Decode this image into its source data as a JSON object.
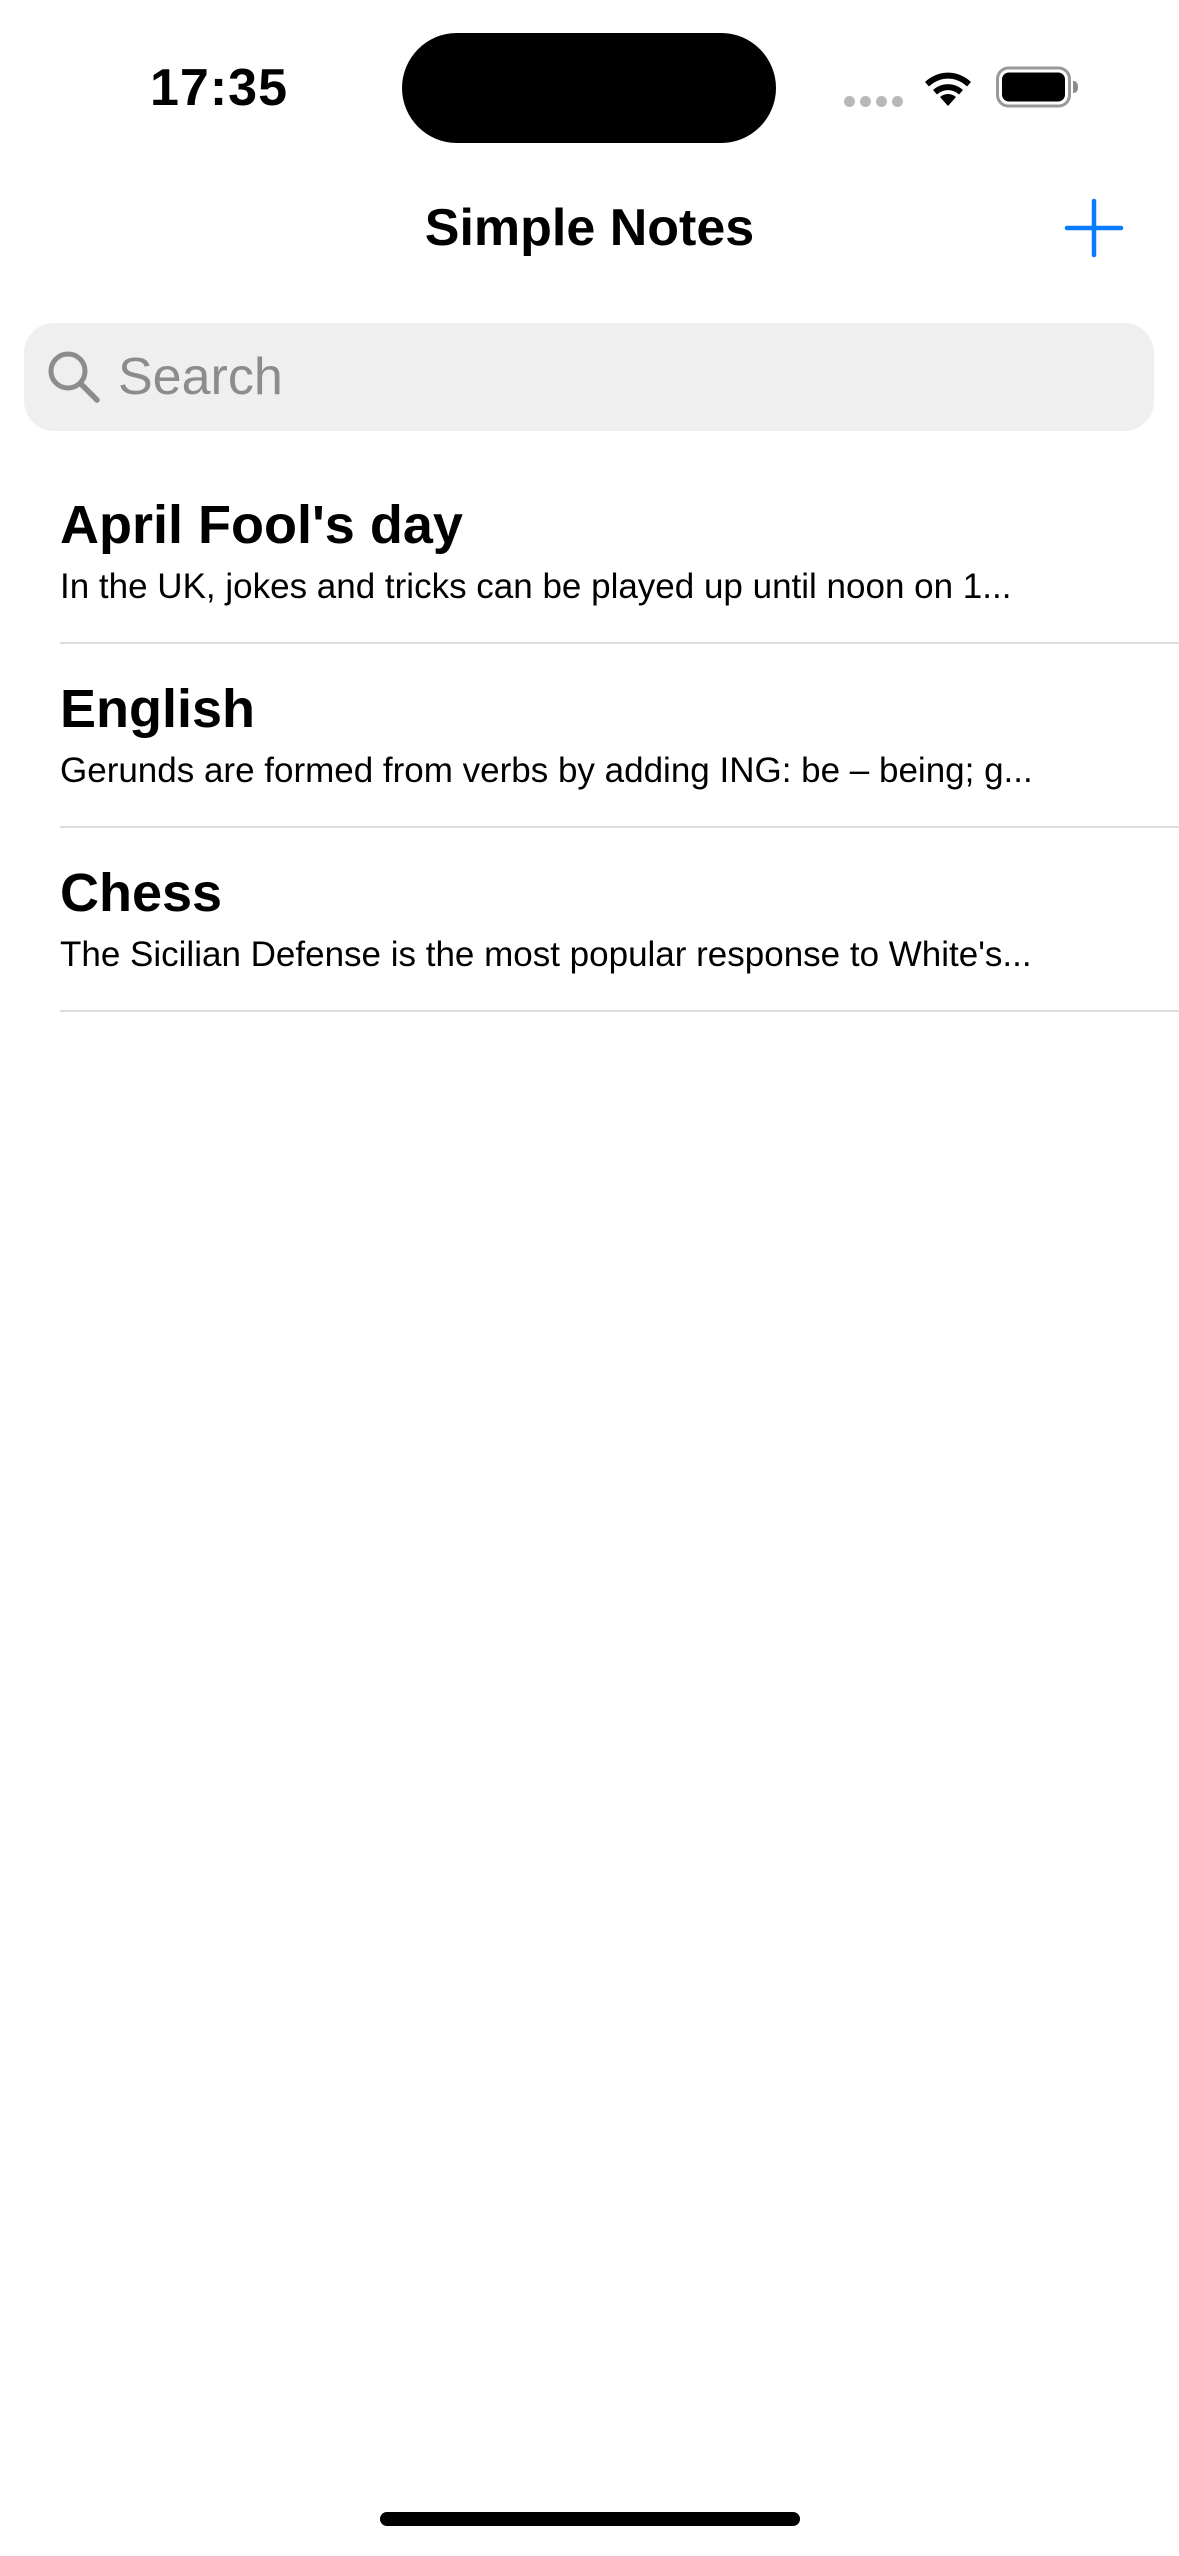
{
  "status_bar": {
    "time": "17:35",
    "icons": [
      "signal-dots-icon",
      "wifi-icon",
      "battery-icon"
    ]
  },
  "nav": {
    "title": "Simple Notes",
    "add_icon": "plus-icon",
    "accent_color": "#0a7aff"
  },
  "search": {
    "placeholder": "Search",
    "value": "",
    "icon": "search-icon"
  },
  "notes": [
    {
      "title": "April Fool's day",
      "preview": "In the UK, jokes and tricks can be played up until noon on 1..."
    },
    {
      "title": "English",
      "preview": "Gerunds are formed from verbs by adding ING: be – being; g..."
    },
    {
      "title": "Chess",
      "preview": "The Sicilian Defense is the most popular response to White's..."
    }
  ]
}
